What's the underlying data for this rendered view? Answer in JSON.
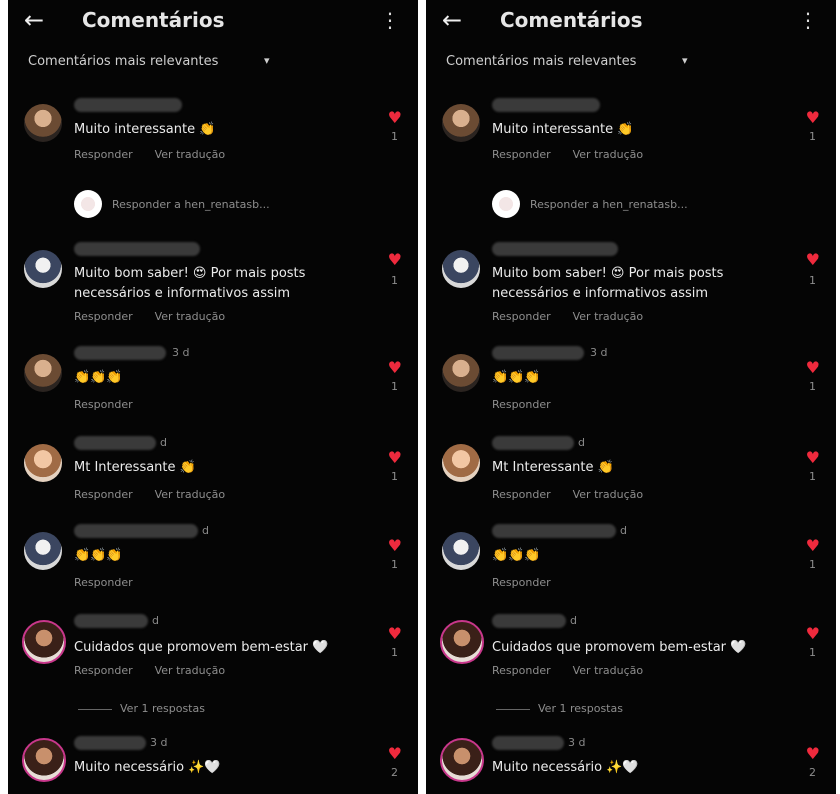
{
  "header": {
    "title": "Comentários",
    "back_icon": "←",
    "menu_icon": "⋮"
  },
  "sort": {
    "label": "Comentários mais relevantes",
    "caret": "▾"
  },
  "actions": {
    "reply": "Responder",
    "translate": "Ver tradução"
  },
  "reply_prompt": "Responder a hen_renatasb...",
  "view_replies": "Ver 1 respostas",
  "heart_glyph": "♥",
  "comments": [
    {
      "text": "Muito interessante 👏",
      "time": "",
      "likes": "1",
      "translate": true
    },
    {
      "text": "Muito bom saber! 😍 Por mais posts necessários e informativos assim",
      "time": "",
      "likes": "1",
      "translate": true
    },
    {
      "text": "👏👏👏",
      "time": "3 d",
      "likes": "1",
      "translate": false
    },
    {
      "text": "Mt Interessante 👏",
      "time": "d",
      "likes": "1",
      "translate": true
    },
    {
      "text": "👏👏👏",
      "time": "d",
      "likes": "1",
      "translate": false
    },
    {
      "text": "Cuidados que promovem bem-estar 🤍",
      "time": "d",
      "likes": "1",
      "translate": true
    },
    {
      "text": "Muito necessário ✨🤍",
      "time": "3 d",
      "likes": "2",
      "translate": true
    }
  ]
}
